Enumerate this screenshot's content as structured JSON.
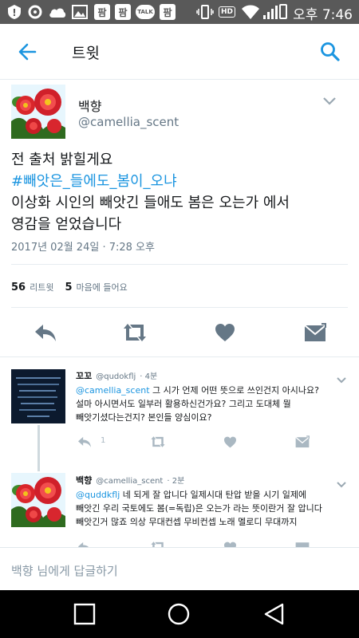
{
  "status_bar": {
    "time": "오후 7:46",
    "icons": [
      "warning-icon",
      "settings-icon",
      "cloud-icon",
      "gallery-icon",
      "app-icon",
      "app-icon",
      "talk-icon",
      "app-icon",
      "vibrate-icon",
      "hd-icon",
      "wifi-icon",
      "signal-icon",
      "battery-icon"
    ],
    "app_badge": "팜",
    "talk_badge": "TALK",
    "hd_label": "HD"
  },
  "header": {
    "title": "트윗",
    "back_icon": "back-arrow-icon",
    "search_icon": "search-icon"
  },
  "tweet": {
    "name": "백향",
    "handle": "@camellia_scent",
    "line1": "전 출처 밝힐게요",
    "hashtag": "#빼앗은_들에도_봄이_오냐",
    "line3": "이상화 시인의 빼앗긴 들애도 봄은 오는가 에서",
    "line4": "영감을 얻었습니다",
    "timestamp": "2017년 02월 24일 · 7:28 오후",
    "retweet_count": "56",
    "retweet_label": "리트윗",
    "like_count": "5",
    "like_label": "마음에 들어요"
  },
  "replies": [
    {
      "name": "꼬꼬",
      "handle": "@qudokflj",
      "time": "· 4분",
      "mention": "@camellia_scent",
      "text_line1": " 그 시가 언제 어떤 뜻으로 쓰인건지 아시나요?",
      "text_line2": "설마 아시면서도 일부러 활용하신건가요? 그리고 도대체 뭘",
      "text_line3": "빼앗기셨다는건지? 본인들 양심이요?",
      "reply_count": "1"
    },
    {
      "name": "백향",
      "handle": "@camellia_scent",
      "time": "· 2분",
      "mention": "@quddkflj",
      "text_line1": " 네 되게 잘 압니다 일제시대 탄압 받을 시기 일제에",
      "text_line2": "빼앗긴 우리 국토에도 봄(=독립)은 오는가 라는 뜻이란거 잘 압니다",
      "text_line3": "빼앗긴거 많죠 의상 무대컨셉 무비컨셉 노래 멜로디 무대까지"
    }
  ],
  "reply_bar": {
    "placeholder": "백향 님에게 답글하기"
  },
  "nav": {
    "icons": [
      "recent-apps-icon",
      "home-icon",
      "back-icon"
    ]
  },
  "colors": {
    "accent": "#1b95e0",
    "icon_gray": "#657786",
    "status_bg": "#595959"
  }
}
